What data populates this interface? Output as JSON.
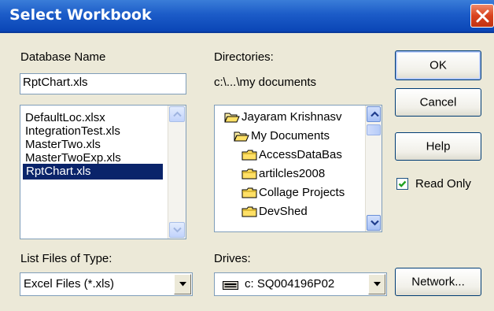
{
  "window": {
    "title": "Select Workbook"
  },
  "database": {
    "label": "Database Name",
    "value": "RptChart.xls",
    "files": [
      {
        "name": "DefaultLoc.xlsx",
        "selected": false
      },
      {
        "name": "IntegrationTest.xls",
        "selected": false
      },
      {
        "name": "MasterTwo.xls",
        "selected": false
      },
      {
        "name": "MasterTwoExp.xls",
        "selected": false
      },
      {
        "name": "RptChart.xls",
        "selected": true
      }
    ]
  },
  "directories": {
    "label": "Directories:",
    "current_path": "c:\\...\\my documents",
    "items": [
      {
        "name": "Jayaram Krishnasv",
        "icon": "open-folder-icon"
      },
      {
        "name": "My Documents",
        "icon": "open-folder-icon"
      },
      {
        "name": "AccessDataBas",
        "icon": "folder-icon"
      },
      {
        "name": "artilcles2008",
        "icon": "folder-icon"
      },
      {
        "name": "Collage Projects",
        "icon": "folder-icon"
      },
      {
        "name": "DevShed",
        "icon": "folder-icon"
      }
    ]
  },
  "file_type": {
    "label": "List Files of Type:",
    "value": "Excel Files (*.xls)"
  },
  "drives": {
    "label": "Drives:",
    "value": "c: SQ004196P02",
    "icon": "drive-icon"
  },
  "buttons": {
    "ok": "OK",
    "cancel": "Cancel",
    "help": "Help",
    "network": "Network..."
  },
  "read_only": {
    "label": "Read Only",
    "checked": true
  },
  "colors": {
    "title_bar": "#1c5cc8",
    "selection": "#0a246a",
    "dialog_bg": "#ece9d8",
    "close_button": "#d9431e"
  }
}
